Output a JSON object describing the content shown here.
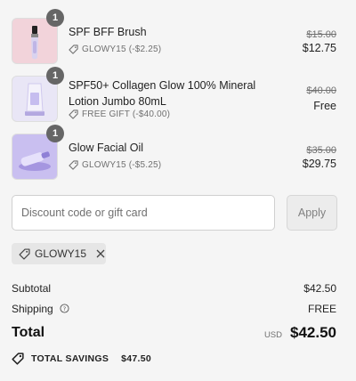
{
  "items": [
    {
      "quantity": "1",
      "name": "SPF BFF Brush",
      "discount_label": "GLOWY15 (-$2.25)",
      "original_price": "$15.00",
      "final_price": "$12.75",
      "thumb_color": "#f2d3da"
    },
    {
      "quantity": "1",
      "name": "SPF50+ Collagen Glow 100% Mineral Lotion Jumbo 80mL",
      "discount_label": "FREE GIFT (-$40.00)",
      "original_price": "$40.00",
      "final_price": "Free",
      "thumb_color": "#e9e6f6"
    },
    {
      "quantity": "1",
      "name": "Glow Facial Oil",
      "discount_label": "GLOWY15 (-$5.25)",
      "original_price": "$35.00",
      "final_price": "$29.75",
      "thumb_color": "#c9bff0"
    }
  ],
  "discount": {
    "placeholder": "Discount code or gift card",
    "apply_label": "Apply",
    "applied_code": "GLOWY15"
  },
  "summary": {
    "subtotal_label": "Subtotal",
    "subtotal_value": "$42.50",
    "shipping_label": "Shipping",
    "shipping_value": "FREE",
    "total_label": "Total",
    "total_currency": "USD",
    "total_value": "$42.50",
    "savings_label": "TOTAL SAVINGS",
    "savings_value": "$47.50"
  },
  "colors": {
    "background": "#f5f5f5",
    "badge": "#666666",
    "muted_text": "#707070"
  }
}
